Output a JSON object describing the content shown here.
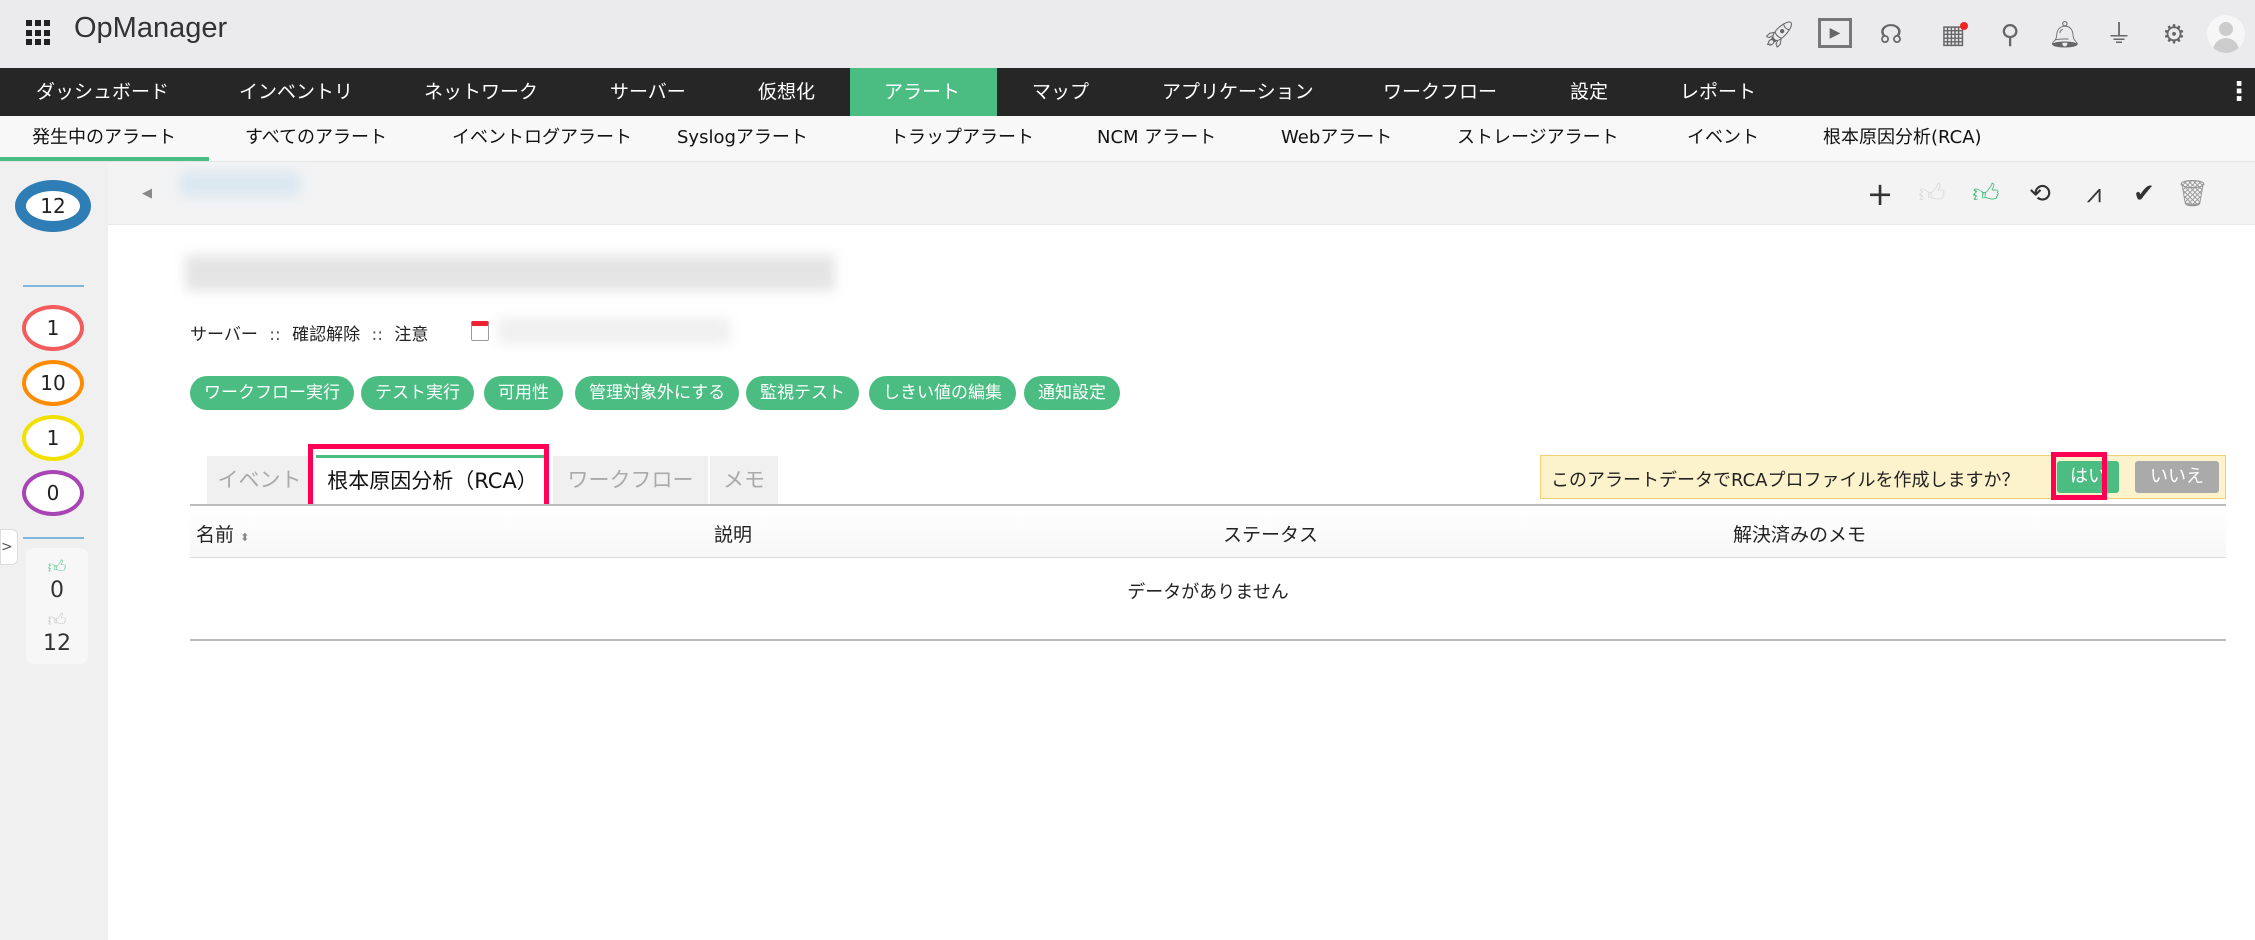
{
  "header": {
    "app_name": "OpManager",
    "icons": [
      "rocket-icon",
      "presentation-icon",
      "headset-icon",
      "gift-icon",
      "search-icon",
      "bell-icon",
      "plug-icon",
      "gear-icon",
      "avatar-icon"
    ]
  },
  "nav": {
    "items": [
      "ダッシュボード",
      "インベントリ",
      "ネットワーク",
      "サーバー",
      "仮想化",
      "アラート",
      "マップ",
      "アプリケーション",
      "ワークフロー",
      "設定",
      "レポート"
    ],
    "active": "アラート"
  },
  "subnav": {
    "items": [
      "発生中のアラート",
      "すべてのアラート",
      "イベントログアラート",
      "Syslogアラート",
      "トラップアラート",
      "NCM アラート",
      "Webアラート",
      "ストレージアラート",
      "イベント",
      "根本原因分析(RCA)"
    ],
    "active": "発生中のアラート"
  },
  "sidebar": {
    "total": "12",
    "critical": "1",
    "trouble": "10",
    "attention": "1",
    "service_down": "0",
    "acknowledged": "0",
    "unacknowledged": "12"
  },
  "alarm": {
    "category": "サーバー",
    "sep": "::",
    "status": "確認解除",
    "severity": "注意"
  },
  "actions": [
    "ワークフロー実行",
    "テスト実行",
    "可用性",
    "管理対象外にする",
    "監視テスト",
    "しきい値の編集",
    "通知設定"
  ],
  "tabs": [
    "イベント",
    "根本原因分析（RCA）",
    "ワークフロー",
    "メモ"
  ],
  "rca_prompt": {
    "text": "このアラートデータでRCAプロファイルを作成しますか？",
    "yes": "はい",
    "no": "いいえ"
  },
  "table": {
    "columns": [
      "名前",
      "説明",
      "ステータス",
      "解決済みのメモ"
    ],
    "empty": "データがありません"
  },
  "colors": {
    "accent": "#4bbd82",
    "highlight": "#ff0055",
    "nav_bg": "#262626"
  }
}
